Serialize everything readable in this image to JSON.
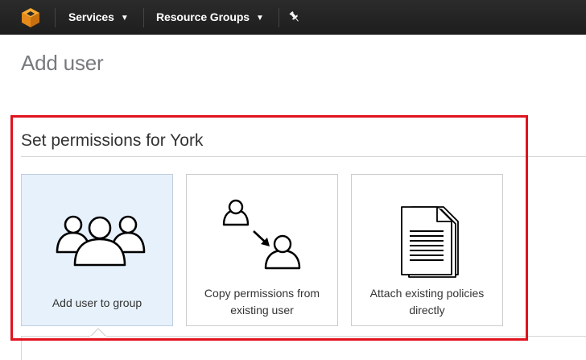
{
  "nav": {
    "logo_icon": "aws-cube-icon",
    "services_label": "Services",
    "resource_groups_label": "Resource Groups",
    "pin_icon": "pin-icon",
    "background": "#232323"
  },
  "page": {
    "title": "Add user"
  },
  "permissions": {
    "section_title": "Set permissions for York",
    "highlight_color": "#e0131f",
    "options": [
      {
        "label": "Add user to group",
        "icon": "user-group-icon",
        "selected": true
      },
      {
        "label_line1": "Copy permissions from",
        "label_line2": "existing user",
        "icon": "copy-user-permissions-icon",
        "selected": false
      },
      {
        "label_line1": "Attach existing policies",
        "label_line2": "directly",
        "icon": "policy-documents-icon",
        "selected": false
      }
    ]
  }
}
